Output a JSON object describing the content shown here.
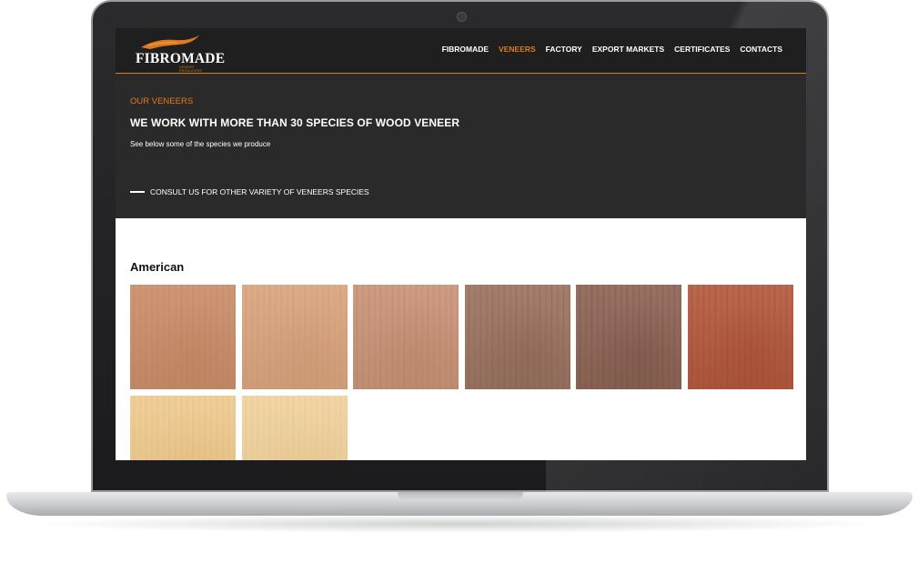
{
  "brand": {
    "name": "FIBROMADE",
    "tagline": "VENEER PRODUCERS",
    "accent": "#e07a1f"
  },
  "nav": {
    "items": [
      {
        "label": "FIBROMADE",
        "active": false
      },
      {
        "label": "VENEERS",
        "active": true
      },
      {
        "label": "FACTORY",
        "active": false
      },
      {
        "label": "EXPORT MARKETS",
        "active": false
      },
      {
        "label": "CERTIFICATES",
        "active": false
      },
      {
        "label": "CONTACTS",
        "active": false
      }
    ]
  },
  "hero": {
    "eyebrow": "OUR VENEERS",
    "title": "WE WORK WITH MORE THAN 30 SPECIES OF WOOD VENEER",
    "subtitle": "See below some of the species we produce",
    "cta": "CONSULT US FOR OTHER VARIETY OF VENEERS SPECIES"
  },
  "section": {
    "title": "American",
    "swatches": [
      {
        "color": "#c98e6a",
        "grain": "#b97a56"
      },
      {
        "color": "#d9a47e",
        "grain": "#c48e69"
      },
      {
        "color": "#c99478",
        "grain": "#a9785c"
      },
      {
        "color": "#9c7462",
        "grain": "#7a5646"
      },
      {
        "color": "#8e6556",
        "grain": "#6a4638"
      },
      {
        "color": "#b35a3e",
        "grain": "#983f2a"
      },
      {
        "color": "#eecb8f",
        "grain": "#dcae6e"
      },
      {
        "color": "#f1d29e",
        "grain": "#e0bb80"
      }
    ]
  }
}
